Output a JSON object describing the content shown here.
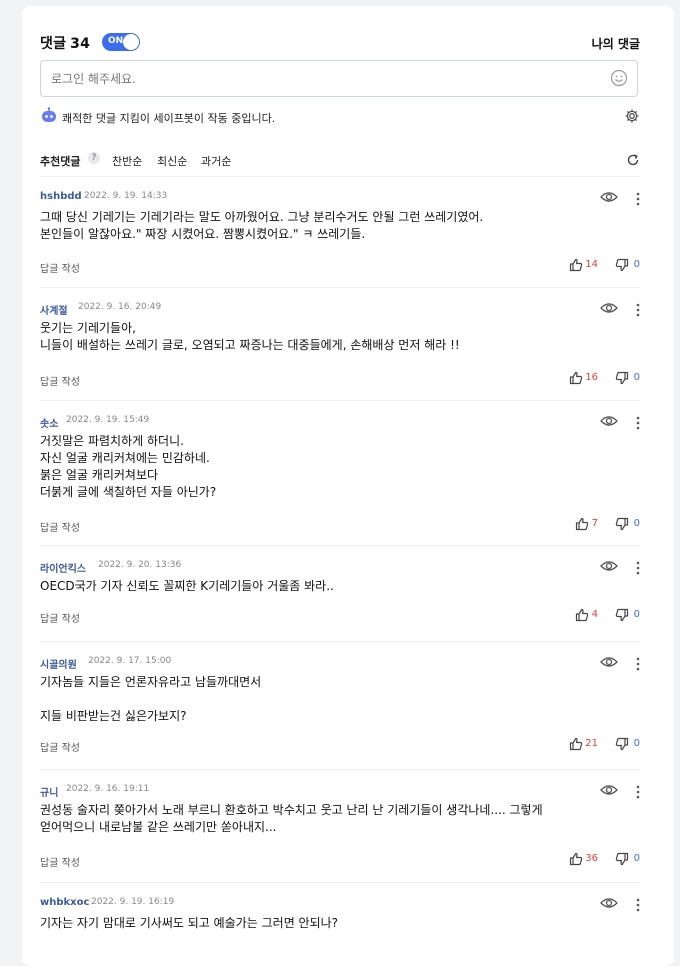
{
  "header": {
    "title": "댓글",
    "count": "34",
    "toggle_label": "ON",
    "my_comments": "나의 댓글"
  },
  "input": {
    "placeholder": "로그인 해주세요."
  },
  "safebot": {
    "text": "쾌적한 댓글 지킴이 세이프봇이 작동 중입니다."
  },
  "sort": {
    "recommended": "추천댓글",
    "help": "?",
    "favorable": "찬반순",
    "newest": "최신순",
    "oldest": "과거순"
  },
  "reply_label": "답글 작성",
  "comments": [
    {
      "author": "hshbdd",
      "date": "2022. 9. 19. 14:33",
      "body": "그때 당신 기레기는 기레기라는 말도 아까웠어요. 그냥 분리수거도 안될  그런 쓰레기였어.\n본인들이 알잖아요.\" 짜장 시켰어요. 짬뽕시켰어요.\"  ㅋ 쓰레기들.",
      "likes": "14",
      "dislikes": "0"
    },
    {
      "author": "사계절",
      "date": "2022. 9. 16. 20:49",
      "body": "웃기는 기레기들아,\n니들이 배설하는 쓰레기 글로, 오염되고 짜증나는 대중들에게, 손해배상 먼저 해라 !!",
      "likes": "16",
      "dislikes": "0"
    },
    {
      "author": "솟소",
      "date": "2022. 9. 19. 15:49",
      "body": "거짓말은 파렴치하게 하더니.\n자신 얼굴 캐리커쳐에는 민감하네.\n붉은 얼굴 캐리커쳐보다\n더붉게 글에 색칠하던 자들 아닌가?",
      "likes": "7",
      "dislikes": "0"
    },
    {
      "author": "라이언킥스",
      "date": "2022. 9. 20. 13:36",
      "body": "OECD국가 기자 신뢰도 꼴찌한 K기레기들아 거울좀 봐라..",
      "likes": "4",
      "dislikes": "0"
    },
    {
      "author": "시골의원",
      "date": "2022. 9. 17. 15:00",
      "body": "기자놈들 지들은 언론자유라고 남들까대면서\n\n지들 비판받는건 싫은가보지?",
      "likes": "21",
      "dislikes": "0"
    },
    {
      "author": "규니",
      "date": "2022. 9. 16. 19:11",
      "body": "권성동 술자리 쫒아가서  노래 부르니 환호하고 박수치고 웃고 난리 난 기레기들이 생각나네.... 그렇게\n얻어먹으니 내로남불 같은 쓰레기만 쏟아내지...",
      "likes": "36",
      "dislikes": "0"
    },
    {
      "author": "whbkxoc",
      "date": "2022. 9. 19. 16:19",
      "body": "기자는 자기 맘대로 기사써도 되고 예술가는 그러면 안되나?",
      "likes": "",
      "dislikes": ""
    }
  ]
}
